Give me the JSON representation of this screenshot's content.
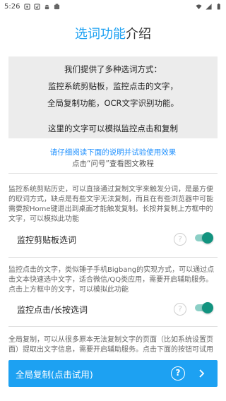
{
  "status_bar": {
    "time": "5:26",
    "left_icons": [
      "notification-icon",
      "notification-icon",
      "android-icon",
      "notification-icon"
    ],
    "right_icons": [
      "wifi-icon",
      "signal-icon",
      "battery-icon"
    ]
  },
  "title": {
    "part1": "选词功能",
    "part2": "介绍"
  },
  "demo_box": {
    "lines": [
      "我们提供了多种选词方式：",
      "监控系统剪贴板，监控点击的文字，",
      "全局复制功能，OCR文字识别功能。",
      "这里的文字可以模拟监控点击和复制"
    ]
  },
  "hint": {
    "link": "请仔细阅读下面的说明并试验使用效果",
    "sub": "点击“问号”查看图文教程"
  },
  "settings": [
    {
      "description": "监控系统剪贴历史，可以直接通过复制文字来触发分词，是最方便的取词方式，缺点是有些文字无法复制，而且在有些浏览器中可能需要按Home键退出到桌面才能触发复制。长按并复制上方框中的文字，可以模拟此功能",
      "label": "监控剪贴板选词",
      "enabled": true
    },
    {
      "description": "监控点击的文字，类似锤子手机Bigbang的实现方式，可以通过点击文本快速选中文字，适合微信/QQ类应用，需要开启辅助服务。点击上方框中的文字，可以模拟此功能",
      "label": "监控点击/长按选词",
      "enabled": true
    }
  ],
  "global_copy": {
    "description": "全局复制，可以从很多原本无法复制文字的页面（比如系统设置页面）提取出文字信息，需要开启辅助服务。点击下面的按钮可试用",
    "button_label": "全局复制(点击试用)"
  },
  "help_glyph": "?",
  "colors": {
    "accent": "#1da1f2",
    "switch_on": "#12937f",
    "link": "#1e90ff"
  }
}
